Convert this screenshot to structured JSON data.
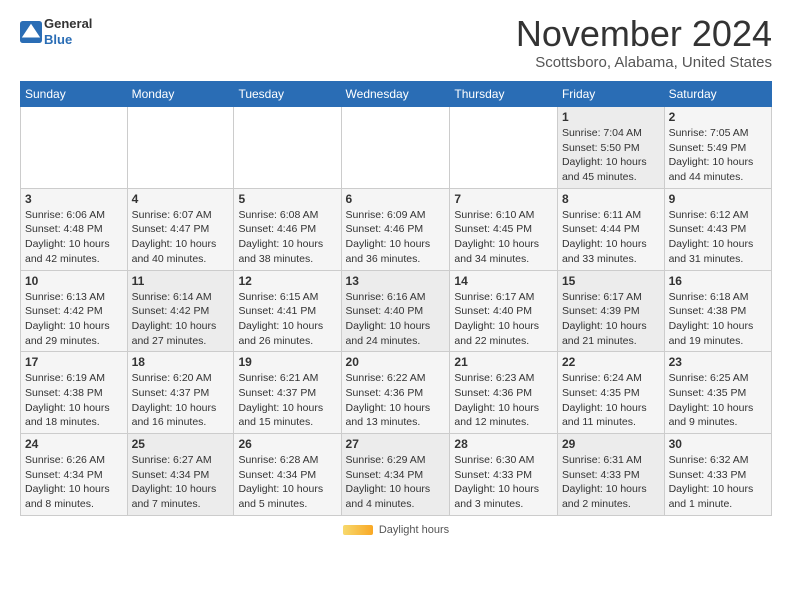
{
  "logo": {
    "general": "General",
    "blue": "Blue"
  },
  "title": "November 2024",
  "location": "Scottsboro, Alabama, United States",
  "legend_label": "Daylight hours",
  "days_of_week": [
    "Sunday",
    "Monday",
    "Tuesday",
    "Wednesday",
    "Thursday",
    "Friday",
    "Saturday"
  ],
  "weeks": [
    [
      {
        "day": "",
        "info": ""
      },
      {
        "day": "",
        "info": ""
      },
      {
        "day": "",
        "info": ""
      },
      {
        "day": "",
        "info": ""
      },
      {
        "day": "",
        "info": ""
      },
      {
        "day": "1",
        "info": "Sunrise: 7:04 AM\nSunset: 5:50 PM\nDaylight: 10 hours\nand 45 minutes."
      },
      {
        "day": "2",
        "info": "Sunrise: 7:05 AM\nSunset: 5:49 PM\nDaylight: 10 hours\nand 44 minutes."
      }
    ],
    [
      {
        "day": "3",
        "info": "Sunrise: 6:06 AM\nSunset: 4:48 PM\nDaylight: 10 hours\nand 42 minutes."
      },
      {
        "day": "4",
        "info": "Sunrise: 6:07 AM\nSunset: 4:47 PM\nDaylight: 10 hours\nand 40 minutes."
      },
      {
        "day": "5",
        "info": "Sunrise: 6:08 AM\nSunset: 4:46 PM\nDaylight: 10 hours\nand 38 minutes."
      },
      {
        "day": "6",
        "info": "Sunrise: 6:09 AM\nSunset: 4:46 PM\nDaylight: 10 hours\nand 36 minutes."
      },
      {
        "day": "7",
        "info": "Sunrise: 6:10 AM\nSunset: 4:45 PM\nDaylight: 10 hours\nand 34 minutes."
      },
      {
        "day": "8",
        "info": "Sunrise: 6:11 AM\nSunset: 4:44 PM\nDaylight: 10 hours\nand 33 minutes."
      },
      {
        "day": "9",
        "info": "Sunrise: 6:12 AM\nSunset: 4:43 PM\nDaylight: 10 hours\nand 31 minutes."
      }
    ],
    [
      {
        "day": "10",
        "info": "Sunrise: 6:13 AM\nSunset: 4:42 PM\nDaylight: 10 hours\nand 29 minutes."
      },
      {
        "day": "11",
        "info": "Sunrise: 6:14 AM\nSunset: 4:42 PM\nDaylight: 10 hours\nand 27 minutes."
      },
      {
        "day": "12",
        "info": "Sunrise: 6:15 AM\nSunset: 4:41 PM\nDaylight: 10 hours\nand 26 minutes."
      },
      {
        "day": "13",
        "info": "Sunrise: 6:16 AM\nSunset: 4:40 PM\nDaylight: 10 hours\nand 24 minutes."
      },
      {
        "day": "14",
        "info": "Sunrise: 6:17 AM\nSunset: 4:40 PM\nDaylight: 10 hours\nand 22 minutes."
      },
      {
        "day": "15",
        "info": "Sunrise: 6:17 AM\nSunset: 4:39 PM\nDaylight: 10 hours\nand 21 minutes."
      },
      {
        "day": "16",
        "info": "Sunrise: 6:18 AM\nSunset: 4:38 PM\nDaylight: 10 hours\nand 19 minutes."
      }
    ],
    [
      {
        "day": "17",
        "info": "Sunrise: 6:19 AM\nSunset: 4:38 PM\nDaylight: 10 hours\nand 18 minutes."
      },
      {
        "day": "18",
        "info": "Sunrise: 6:20 AM\nSunset: 4:37 PM\nDaylight: 10 hours\nand 16 minutes."
      },
      {
        "day": "19",
        "info": "Sunrise: 6:21 AM\nSunset: 4:37 PM\nDaylight: 10 hours\nand 15 minutes."
      },
      {
        "day": "20",
        "info": "Sunrise: 6:22 AM\nSunset: 4:36 PM\nDaylight: 10 hours\nand 13 minutes."
      },
      {
        "day": "21",
        "info": "Sunrise: 6:23 AM\nSunset: 4:36 PM\nDaylight: 10 hours\nand 12 minutes."
      },
      {
        "day": "22",
        "info": "Sunrise: 6:24 AM\nSunset: 4:35 PM\nDaylight: 10 hours\nand 11 minutes."
      },
      {
        "day": "23",
        "info": "Sunrise: 6:25 AM\nSunset: 4:35 PM\nDaylight: 10 hours\nand 9 minutes."
      }
    ],
    [
      {
        "day": "24",
        "info": "Sunrise: 6:26 AM\nSunset: 4:34 PM\nDaylight: 10 hours\nand 8 minutes."
      },
      {
        "day": "25",
        "info": "Sunrise: 6:27 AM\nSunset: 4:34 PM\nDaylight: 10 hours\nand 7 minutes."
      },
      {
        "day": "26",
        "info": "Sunrise: 6:28 AM\nSunset: 4:34 PM\nDaylight: 10 hours\nand 5 minutes."
      },
      {
        "day": "27",
        "info": "Sunrise: 6:29 AM\nSunset: 4:34 PM\nDaylight: 10 hours\nand 4 minutes."
      },
      {
        "day": "28",
        "info": "Sunrise: 6:30 AM\nSunset: 4:33 PM\nDaylight: 10 hours\nand 3 minutes."
      },
      {
        "day": "29",
        "info": "Sunrise: 6:31 AM\nSunset: 4:33 PM\nDaylight: 10 hours\nand 2 minutes."
      },
      {
        "day": "30",
        "info": "Sunrise: 6:32 AM\nSunset: 4:33 PM\nDaylight: 10 hours\nand 1 minute."
      }
    ]
  ]
}
